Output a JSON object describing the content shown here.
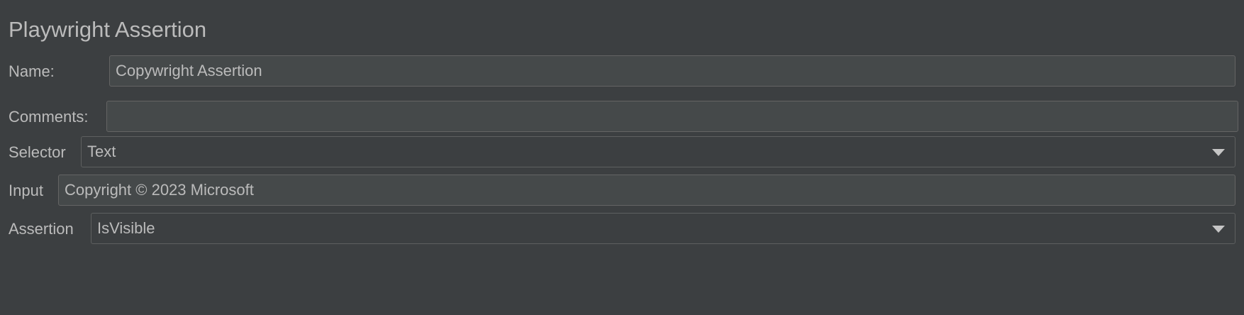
{
  "panel": {
    "title": "Playwright Assertion"
  },
  "form": {
    "name": {
      "label": "Name:",
      "value": "Copywright Assertion"
    },
    "comments": {
      "label": "Comments:",
      "value": ""
    },
    "selector": {
      "label": "Selector",
      "value": "Text"
    },
    "input": {
      "label": "Input",
      "value": "Copyright © 2023 Microsoft"
    },
    "assertion": {
      "label": "Assertion",
      "value": "IsVisible"
    }
  },
  "icons": {
    "dropdown": "chevron-down-icon"
  }
}
